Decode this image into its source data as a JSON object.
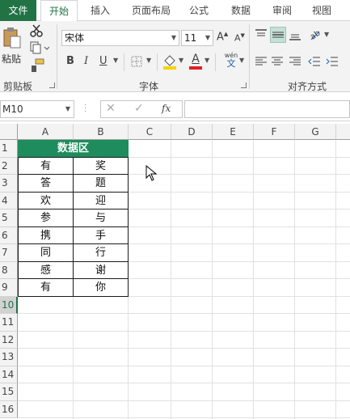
{
  "tabs": [
    "文件",
    "开始",
    "插入",
    "页面布局",
    "公式",
    "数据",
    "审阅",
    "视图"
  ],
  "ribbon": {
    "paste_label": "粘贴",
    "clipboard_label": "剪贴板",
    "font_name": "宋体",
    "font_size": "11",
    "font_group_label": "字体",
    "align_group_label": "对齐方式",
    "bold": "B",
    "italic": "I",
    "underline": "U",
    "font_color_letter": "A",
    "phonetic_top": "wén",
    "phonetic_bottom": "文",
    "grow_font": "A",
    "shrink_font": "A"
  },
  "formula_bar": {
    "name_box": "M10",
    "fx": "fx",
    "value": ""
  },
  "grid": {
    "columns": [
      "A",
      "B",
      "C",
      "D",
      "E",
      "F",
      "G"
    ],
    "rows": [
      "1",
      "2",
      "3",
      "4",
      "5",
      "6",
      "7",
      "8",
      "9",
      "10",
      "11",
      "12",
      "13",
      "14",
      "15",
      "16"
    ],
    "selected_row": "10",
    "header": "数据区",
    "col_a": [
      "有",
      "答",
      "欢",
      "参",
      "携",
      "同",
      "感",
      "有"
    ],
    "col_b": [
      "奖",
      "题",
      "迎",
      "与",
      "手",
      "行",
      "谢",
      "你"
    ]
  },
  "colors": {
    "brand": "#217346",
    "header_fill": "#1f8c5d",
    "font_color_bar": "#e02020",
    "fill_color_bar": "#f5d400"
  }
}
